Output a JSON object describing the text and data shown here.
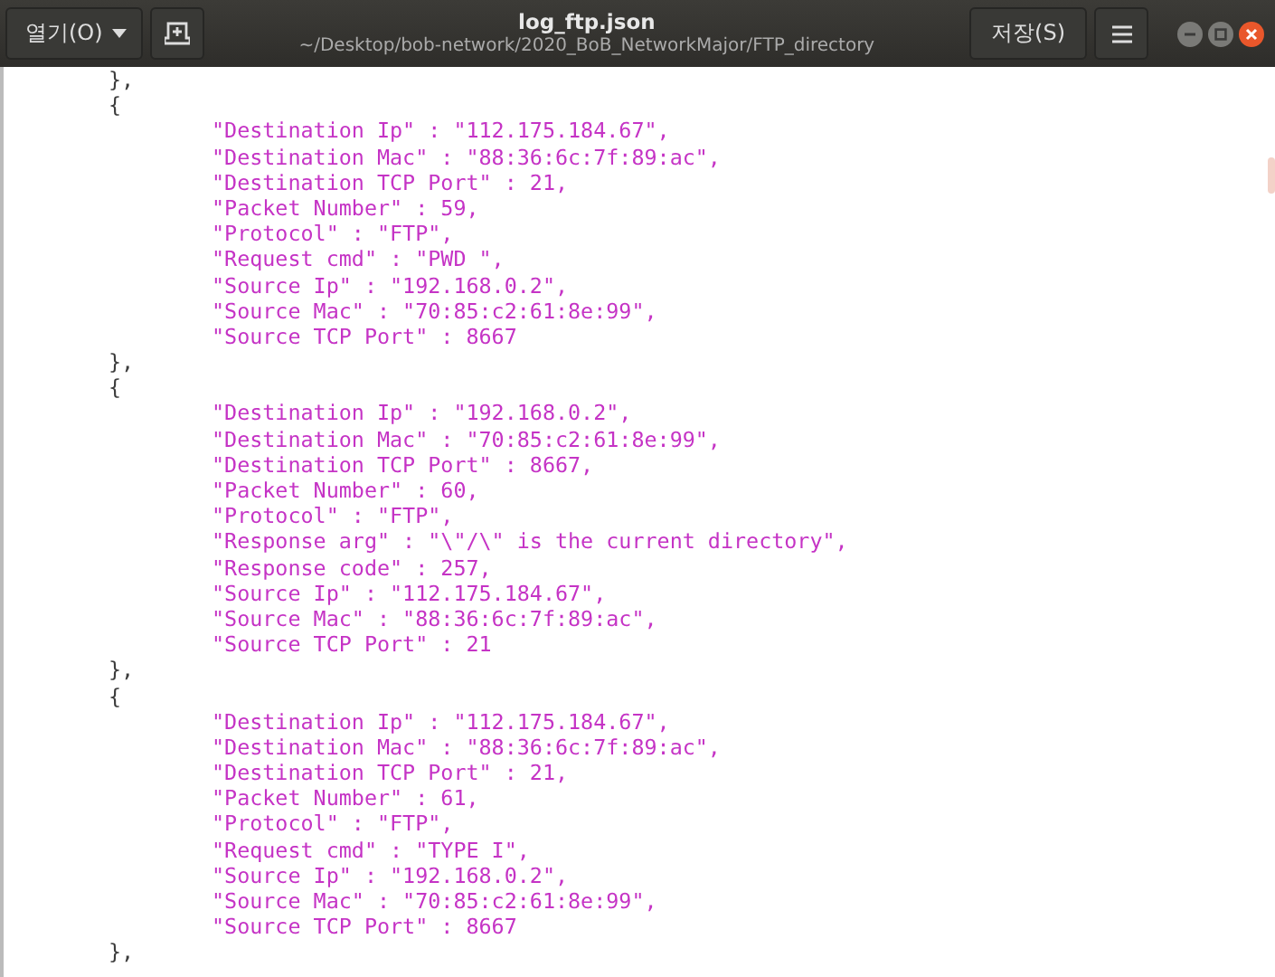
{
  "header": {
    "open_button": "열기(O)",
    "title": "log_ftp.json",
    "subtitle": "~/Desktop/bob-network/2020_BoB_NetworkMajor/FTP_directory",
    "save_button": "저장(S)"
  },
  "editor": {
    "leading_close": "},",
    "records": [
      {
        "open": "{",
        "close": "},",
        "fields": [
          "\"Destination Ip\" : \"112.175.184.67\",",
          "\"Destination Mac\" : \"88:36:6c:7f:89:ac\",",
          "\"Destination TCP Port\" : 21,",
          "\"Packet Number\" : 59,",
          "\"Protocol\" : \"FTP\",",
          "\"Request cmd\" : \"PWD \",",
          "\"Source Ip\" : \"192.168.0.2\",",
          "\"Source Mac\" : \"70:85:c2:61:8e:99\",",
          "\"Source TCP Port\" : 8667"
        ]
      },
      {
        "open": "{",
        "close": "},",
        "fields": [
          "\"Destination Ip\" : \"192.168.0.2\",",
          "\"Destination Mac\" : \"70:85:c2:61:8e:99\",",
          "\"Destination TCP Port\" : 8667,",
          "\"Packet Number\" : 60,",
          "\"Protocol\" : \"FTP\",",
          "\"Response arg\" : \"\\\"/\\\" is the current directory\",",
          "\"Response code\" : 257,",
          "\"Source Ip\" : \"112.175.184.67\",",
          "\"Source Mac\" : \"88:36:6c:7f:89:ac\",",
          "\"Source TCP Port\" : 21"
        ]
      },
      {
        "open": "{",
        "close": "},",
        "fields": [
          "\"Destination Ip\" : \"112.175.184.67\",",
          "\"Destination Mac\" : \"88:36:6c:7f:89:ac\",",
          "\"Destination TCP Port\" : 21,",
          "\"Packet Number\" : 61,",
          "\"Protocol\" : \"FTP\",",
          "\"Request cmd\" : \"TYPE I\",",
          "\"Source Ip\" : \"192.168.0.2\",",
          "\"Source Mac\" : \"70:85:c2:61:8e:99\",",
          "\"Source TCP Port\" : 8667"
        ]
      }
    ]
  }
}
